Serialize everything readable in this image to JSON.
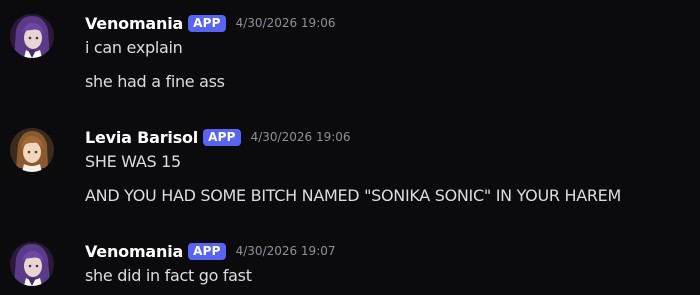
{
  "messages": [
    {
      "username": "Venomania",
      "badge": "APP",
      "timestamp": "4/30/2026 19:06",
      "avatar_icon": "purple-hair-character-avatar",
      "lines": [
        "i can explain",
        "she had a fine ass"
      ]
    },
    {
      "username": "Levia Barisol",
      "badge": "APP",
      "timestamp": "4/30/2026 19:06",
      "avatar_icon": "brown-hair-character-avatar",
      "lines": [
        "SHE WAS 15",
        "AND YOU HAD SOME BITCH NAMED \"SONIKA SONIC\" IN YOUR HAREM"
      ]
    },
    {
      "username": "Venomania",
      "badge": "APP",
      "timestamp": "4/30/2026 19:07",
      "avatar_icon": "purple-hair-character-avatar",
      "lines": [
        "she did in fact go fast"
      ]
    }
  ],
  "colors": {
    "background": "#0b0b0d",
    "username": "#ffffff",
    "badge": "#5865f2",
    "timestamp": "#8e9099",
    "text": "#dcdde1"
  }
}
